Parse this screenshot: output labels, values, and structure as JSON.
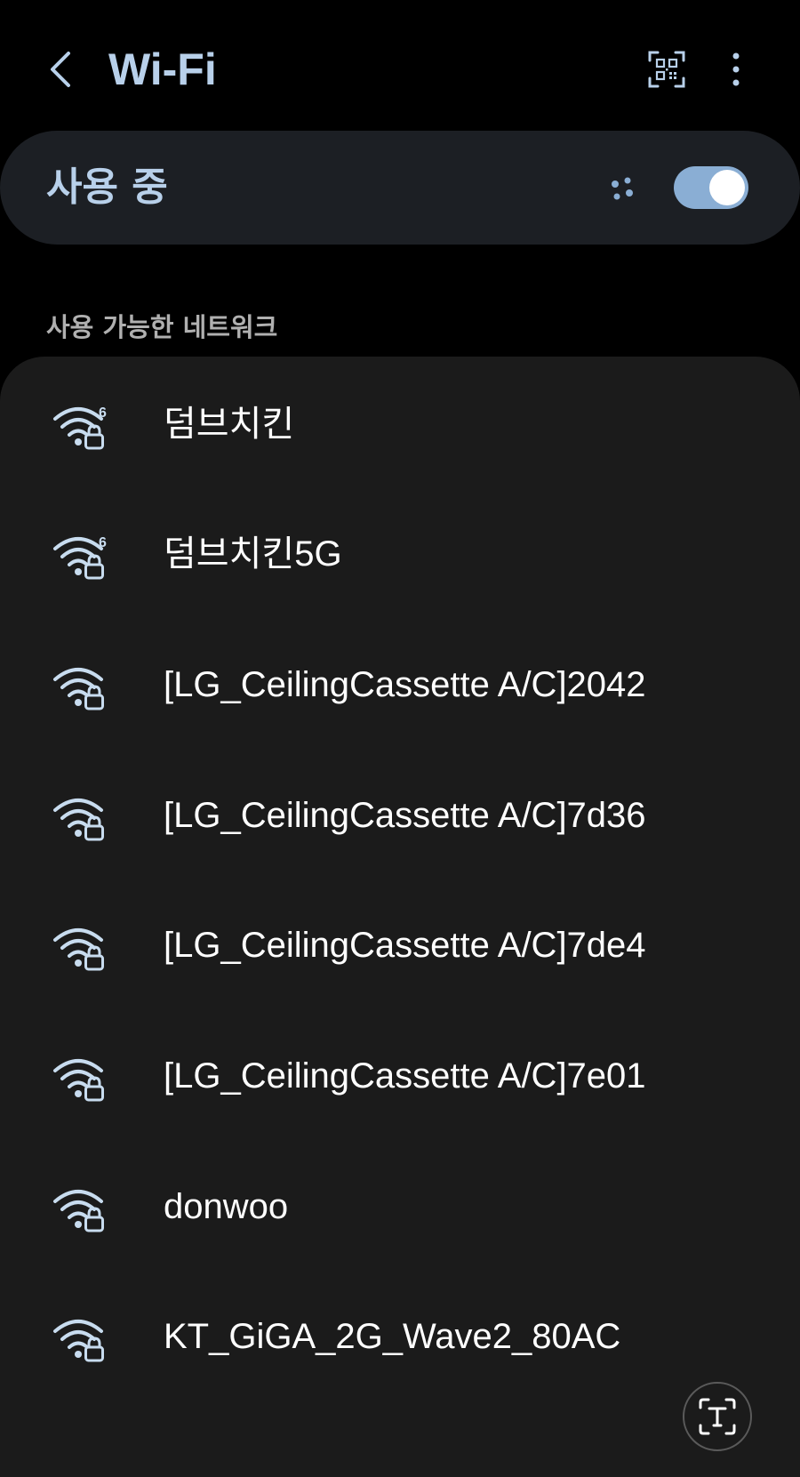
{
  "header": {
    "title": "Wi-Fi",
    "back_icon": "chevron-left-icon",
    "qr_icon": "qr-code-scan-icon",
    "more_icon": "more-vertical-icon"
  },
  "master_switch": {
    "label": "사용 중",
    "scanning_icon": "scanning-dots-icon",
    "enabled": true
  },
  "available_networks": {
    "header": "사용 가능한 네트워크",
    "items": [
      {
        "ssid": "덤브치킨",
        "wifi_generation": "6",
        "secured": true
      },
      {
        "ssid": "덤브치킨5G",
        "wifi_generation": "6",
        "secured": true
      },
      {
        "ssid": "[LG_CeilingCassette A/C]2042",
        "secured": true
      },
      {
        "ssid": "[LG_CeilingCassette A/C]7d36",
        "secured": true
      },
      {
        "ssid": "[LG_CeilingCassette A/C]7de4",
        "secured": true
      },
      {
        "ssid": "[LG_CeilingCassette A/C]7e01",
        "secured": true
      },
      {
        "ssid": "donwoo",
        "secured": true
      },
      {
        "ssid": "KT_GiGA_2G_Wave2_80AC",
        "secured": true
      }
    ]
  },
  "floating": {
    "text_extract_icon": "text-extract-icon"
  },
  "colors": {
    "background": "#000000",
    "card": "#1b1b1b",
    "switch_row": "#1c1f24",
    "accent": "#b8d0ea",
    "toggle_on": "#8aaed4",
    "wifi_icon": "#c8dcef"
  }
}
